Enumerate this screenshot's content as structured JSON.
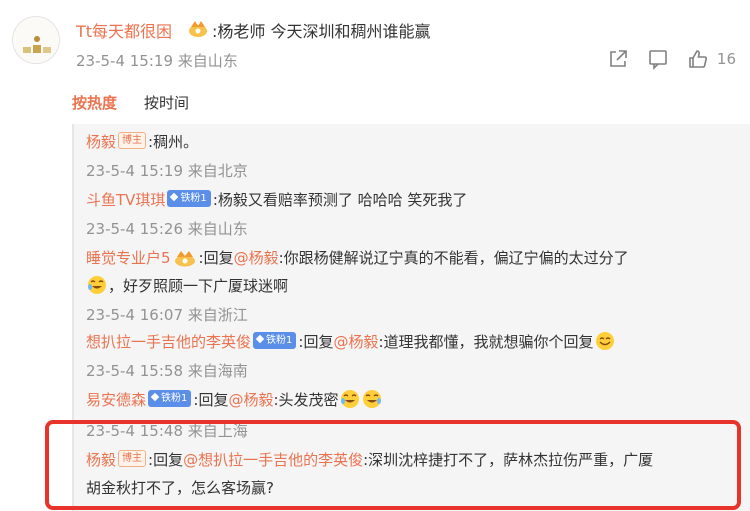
{
  "post": {
    "author": "Tt每天都很困",
    "text": ":杨老师 今天深圳和稠州谁能赢",
    "date": "23-5-4 15:19",
    "location": "来自山东",
    "like_count": "16"
  },
  "sort": {
    "hot": "按热度",
    "time": "按时间"
  },
  "replies": [
    {
      "user": "杨毅",
      "badge": "博主",
      "text": ":稠州。",
      "date": "23-5-4 15:19",
      "location": "来自北京"
    },
    {
      "user": "斗鱼TV琪琪",
      "badge": "铁粉1",
      "text": ":杨毅又看赔率预测了 哈哈哈 笑死我了",
      "date": "23-5-4 15:26",
      "location": "来自山东"
    },
    {
      "user": "睡觉专业户5",
      "prefix": ":回复",
      "at": "@杨毅",
      "text": ":你跟杨健解说辽宁真的不能看，偏辽宁偏的太过分了",
      "text2": "，好歹照顾一下广厦球迷啊",
      "date": "23-5-4 16:07",
      "location": "来自浙江"
    },
    {
      "user": "想扒拉一手吉他的李英俊",
      "badge": "铁粉1",
      "prefix": ":回复",
      "at": "@杨毅",
      "text": ":道理我都懂，我就想骗你个回复",
      "date": "23-5-4 15:58",
      "location": "来自海南"
    },
    {
      "user": "易安德森",
      "badge": "铁粉1",
      "prefix": ":回复",
      "at": "@杨毅",
      "text": ":头发茂密",
      "date": "23-5-4 15:48",
      "location": "来自上海"
    },
    {
      "user": "杨毅",
      "badge": "博主",
      "prefix": ":回复",
      "at": "@想扒拉一手吉他的李英俊",
      "text": ":深圳沈梓捷打不了，萨林杰拉伤严重，广厦",
      "text2": "胡金秋打不了，怎么客场赢?"
    }
  ]
}
